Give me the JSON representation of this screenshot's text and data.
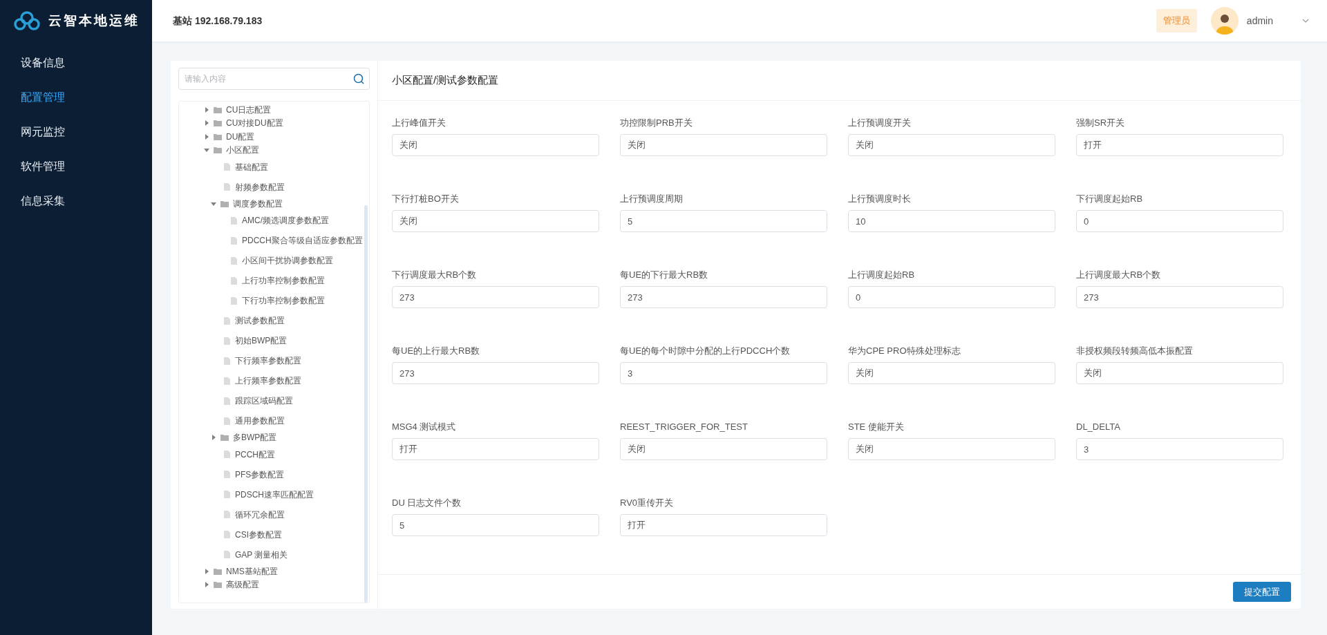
{
  "app": {
    "title": "云智本地运维"
  },
  "nav": [
    {
      "label": "设备信息",
      "selected": false
    },
    {
      "label": "配置管理",
      "selected": true
    },
    {
      "label": "网元监控",
      "selected": false
    },
    {
      "label": "软件管理",
      "selected": false
    },
    {
      "label": "信息采集",
      "selected": false
    }
  ],
  "header": {
    "station": "基站 192.168.79.183",
    "role_badge": "管理员",
    "user": "admin"
  },
  "search": {
    "placeholder": "请输入内容"
  },
  "tree": [
    {
      "kind": "folder",
      "label": "CU日志配置",
      "expanded": false
    },
    {
      "kind": "folder",
      "label": "CU对接DU配置",
      "expanded": false
    },
    {
      "kind": "folder",
      "label": "DU配置",
      "expanded": false
    },
    {
      "kind": "folder",
      "label": "小区配置",
      "expanded": true,
      "children": [
        {
          "kind": "file",
          "label": "基础配置"
        },
        {
          "kind": "file",
          "label": "射频参数配置"
        },
        {
          "kind": "folder",
          "label": "调度参数配置",
          "expanded": true,
          "children": [
            {
              "kind": "file",
              "label": "AMC/频选调度参数配置"
            },
            {
              "kind": "file",
              "label": "PDCCH聚合等级自适应参数配置"
            },
            {
              "kind": "file",
              "label": "小区间干扰协调参数配置"
            },
            {
              "kind": "file",
              "label": "上行功率控制参数配置"
            },
            {
              "kind": "file",
              "label": "下行功率控制参数配置"
            }
          ]
        },
        {
          "kind": "file",
          "label": "测试参数配置"
        },
        {
          "kind": "file",
          "label": "初始BWP配置"
        },
        {
          "kind": "file",
          "label": "下行频率参数配置"
        },
        {
          "kind": "file",
          "label": "上行频率参数配置"
        },
        {
          "kind": "file",
          "label": "跟踪区域码配置"
        },
        {
          "kind": "file",
          "label": "通用参数配置"
        },
        {
          "kind": "folder",
          "label": "多BWP配置",
          "expanded": false
        },
        {
          "kind": "file",
          "label": "PCCH配置"
        },
        {
          "kind": "file",
          "label": "PFS参数配置"
        },
        {
          "kind": "file",
          "label": "PDSCH速率匹配配置"
        },
        {
          "kind": "file",
          "label": "循环冗余配置"
        },
        {
          "kind": "file",
          "label": "CSI参数配置"
        },
        {
          "kind": "file",
          "label": "GAP 测量相关"
        }
      ]
    },
    {
      "kind": "folder",
      "label": "NMS基站配置",
      "expanded": false
    },
    {
      "kind": "folder",
      "label": "高级配置",
      "expanded": false
    }
  ],
  "form": {
    "title": "小区配置/测试参数配置",
    "fields": [
      {
        "label": "上行峰值开关",
        "value": "关闭"
      },
      {
        "label": "功控限制PRB开关",
        "value": "关闭"
      },
      {
        "label": "上行预调度开关",
        "value": "关闭"
      },
      {
        "label": "强制SR开关",
        "value": "打开"
      },
      {
        "label": "下行打桩BO开关",
        "value": "关闭"
      },
      {
        "label": "上行预调度周期",
        "value": "5"
      },
      {
        "label": "上行预调度时长",
        "value": "10"
      },
      {
        "label": "下行调度起始RB",
        "value": "0"
      },
      {
        "label": "下行调度最大RB个数",
        "value": "273"
      },
      {
        "label": "每UE的下行最大RB数",
        "value": "273"
      },
      {
        "label": "上行调度起始RB",
        "value": "0"
      },
      {
        "label": "上行调度最大RB个数",
        "value": "273"
      },
      {
        "label": "每UE的上行最大RB数",
        "value": "273"
      },
      {
        "label": "每UE的每个时隙中分配的上行PDCCH个数",
        "value": "3"
      },
      {
        "label": "华为CPE PRO特殊处理标志",
        "value": "关闭"
      },
      {
        "label": "非授权频段转频高低本振配置",
        "value": "关闭"
      },
      {
        "label": "MSG4 测试模式",
        "value": "打开"
      },
      {
        "label": "REEST_TRIGGER_FOR_TEST",
        "value": "关闭"
      },
      {
        "label": "STE 使能开关",
        "value": "关闭"
      },
      {
        "label": "DL_DELTA",
        "value": "3"
      },
      {
        "label": "DU 日志文件个数",
        "value": "5"
      },
      {
        "label": "RV0重传开关",
        "value": "打开"
      }
    ],
    "submit": "提交配置"
  }
}
